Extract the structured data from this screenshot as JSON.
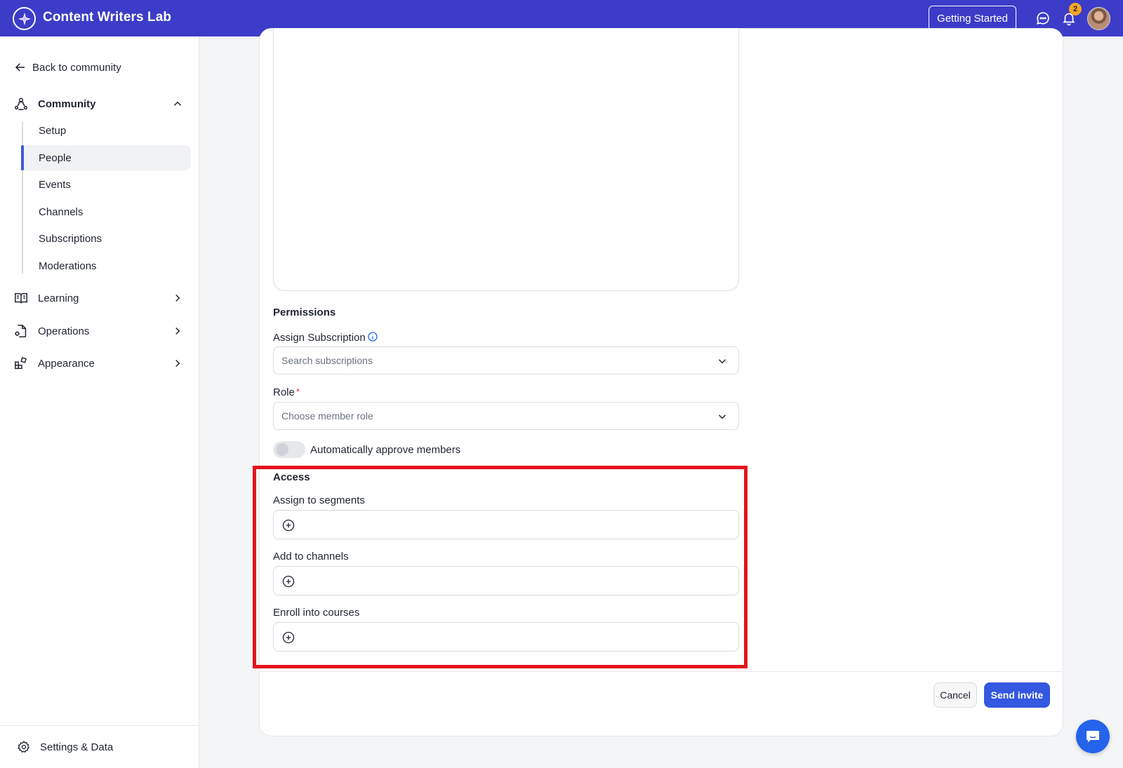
{
  "header": {
    "app_name": "Content Writers Lab",
    "getting_started": "Getting Started",
    "notification_count": "2"
  },
  "sidebar": {
    "back": "Back to community",
    "community": "Community",
    "sub_items": [
      "Setup",
      "People",
      "Events",
      "Channels",
      "Subscriptions",
      "Moderations"
    ],
    "active_item": "People",
    "learning": "Learning",
    "operations": "Operations",
    "appearance": "Appearance",
    "settings": "Settings & Data"
  },
  "form": {
    "permissions_heading": "Permissions",
    "assign_subscription_label": "Assign Subscription",
    "subscription_placeholder": "Search subscriptions",
    "role_label": "Role",
    "role_required_mark": "*",
    "role_placeholder": "Choose member role",
    "auto_approve_label": "Automatically approve members",
    "auto_approve_on": false,
    "access_heading": "Access",
    "segments_label": "Assign to segments",
    "channels_label": "Add to channels",
    "courses_label": "Enroll into courses",
    "cancel": "Cancel",
    "send_invite": "Send invite"
  },
  "colors": {
    "header_bg": "#3d3cc8",
    "primary": "#3458e0",
    "highlight_box": "#e3141d",
    "badge": "#f5a623"
  }
}
